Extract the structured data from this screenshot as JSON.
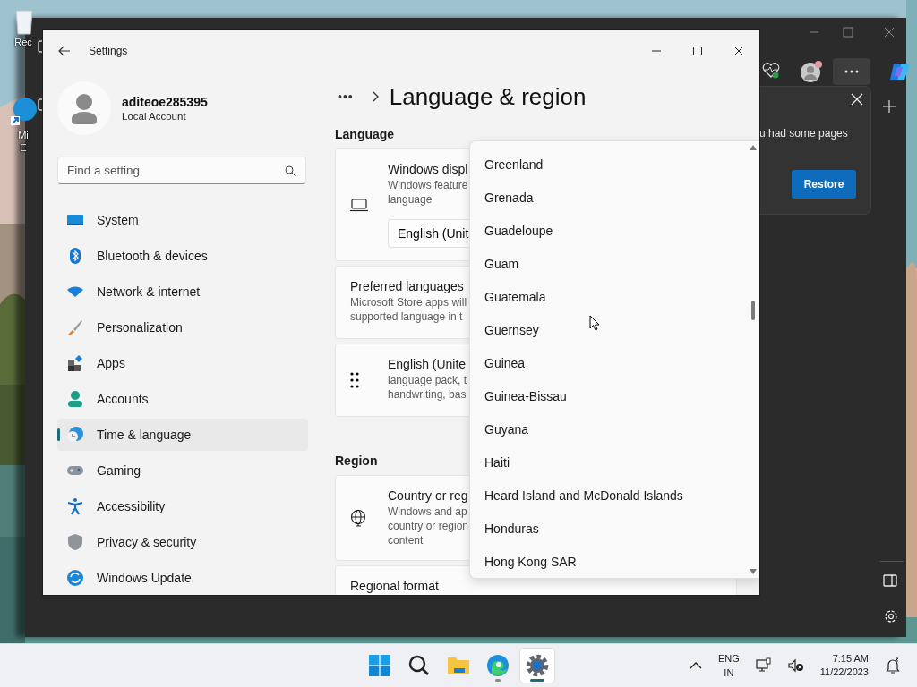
{
  "desktop": {
    "icons": [
      {
        "kind": "bin",
        "label_lines": [
          "Rec"
        ]
      },
      {
        "kind": "edge",
        "label_lines": [
          "Mi",
          "E"
        ]
      }
    ]
  },
  "browser": {
    "popup": {
      "message": "u had some pages",
      "button": "Restore"
    }
  },
  "settings": {
    "title": "Settings",
    "user": {
      "name": "aditeoe285395",
      "account_type": "Local Account"
    },
    "search": {
      "placeholder": "Find a setting"
    },
    "nav": [
      {
        "label": "System",
        "kind": "system",
        "selected": false
      },
      {
        "label": "Bluetooth & devices",
        "kind": "bluetooth",
        "selected": false
      },
      {
        "label": "Network & internet",
        "kind": "network",
        "selected": false
      },
      {
        "label": "Personalization",
        "kind": "brush",
        "selected": false
      },
      {
        "label": "Apps",
        "kind": "apps",
        "selected": false
      },
      {
        "label": "Accounts",
        "kind": "accounts",
        "selected": false
      },
      {
        "label": "Time & language",
        "kind": "time",
        "selected": true
      },
      {
        "label": "Gaming",
        "kind": "gaming",
        "selected": false
      },
      {
        "label": "Accessibility",
        "kind": "accessibility",
        "selected": false
      },
      {
        "label": "Privacy & security",
        "kind": "shield",
        "selected": false
      },
      {
        "label": "Windows Update",
        "kind": "update",
        "selected": false
      }
    ],
    "breadcrumb_overflow": "•••",
    "page_title": "Language & region",
    "sections": [
      {
        "heading": "Language",
        "cards": [
          {
            "kind": "laptop",
            "title": "Windows displ",
            "lines": [
              "Windows feature",
              "language"
            ],
            "value": "English (Unit"
          },
          {
            "kind": "text",
            "title": "Preferred languages",
            "lines": [
              "Microsoft Store apps will",
              "supported language in t"
            ]
          },
          {
            "kind": "grip",
            "title": "English (Unite",
            "lines": [
              "language pack, t",
              "handwriting, bas"
            ]
          }
        ]
      },
      {
        "heading": "Region",
        "cards": [
          {
            "kind": "globe",
            "title": "Country or reg",
            "lines": [
              "Windows and ap",
              "country or region",
              "content"
            ]
          },
          {
            "kind": "text",
            "title": "Regional format"
          }
        ]
      }
    ],
    "dropdown": {
      "items": [
        "Greenland",
        "Grenada",
        "Guadeloupe",
        "Guam",
        "Guatemala",
        "Guernsey",
        "Guinea",
        "Guinea-Bissau",
        "Guyana",
        "Haiti",
        "Heard Island and McDonald Islands",
        "Honduras",
        "Hong Kong SAR"
      ]
    }
  },
  "taskbar": {
    "apps": [
      {
        "kind": "start",
        "running": false,
        "active": false
      },
      {
        "kind": "search",
        "running": false,
        "active": false
      },
      {
        "kind": "folder",
        "running": false,
        "active": false
      },
      {
        "kind": "edge",
        "running": true,
        "active": false
      },
      {
        "kind": "settings",
        "running": true,
        "active": true
      }
    ],
    "language": [
      "ENG",
      "IN"
    ],
    "time": "7:15 AM",
    "date": "11/22/2023"
  }
}
